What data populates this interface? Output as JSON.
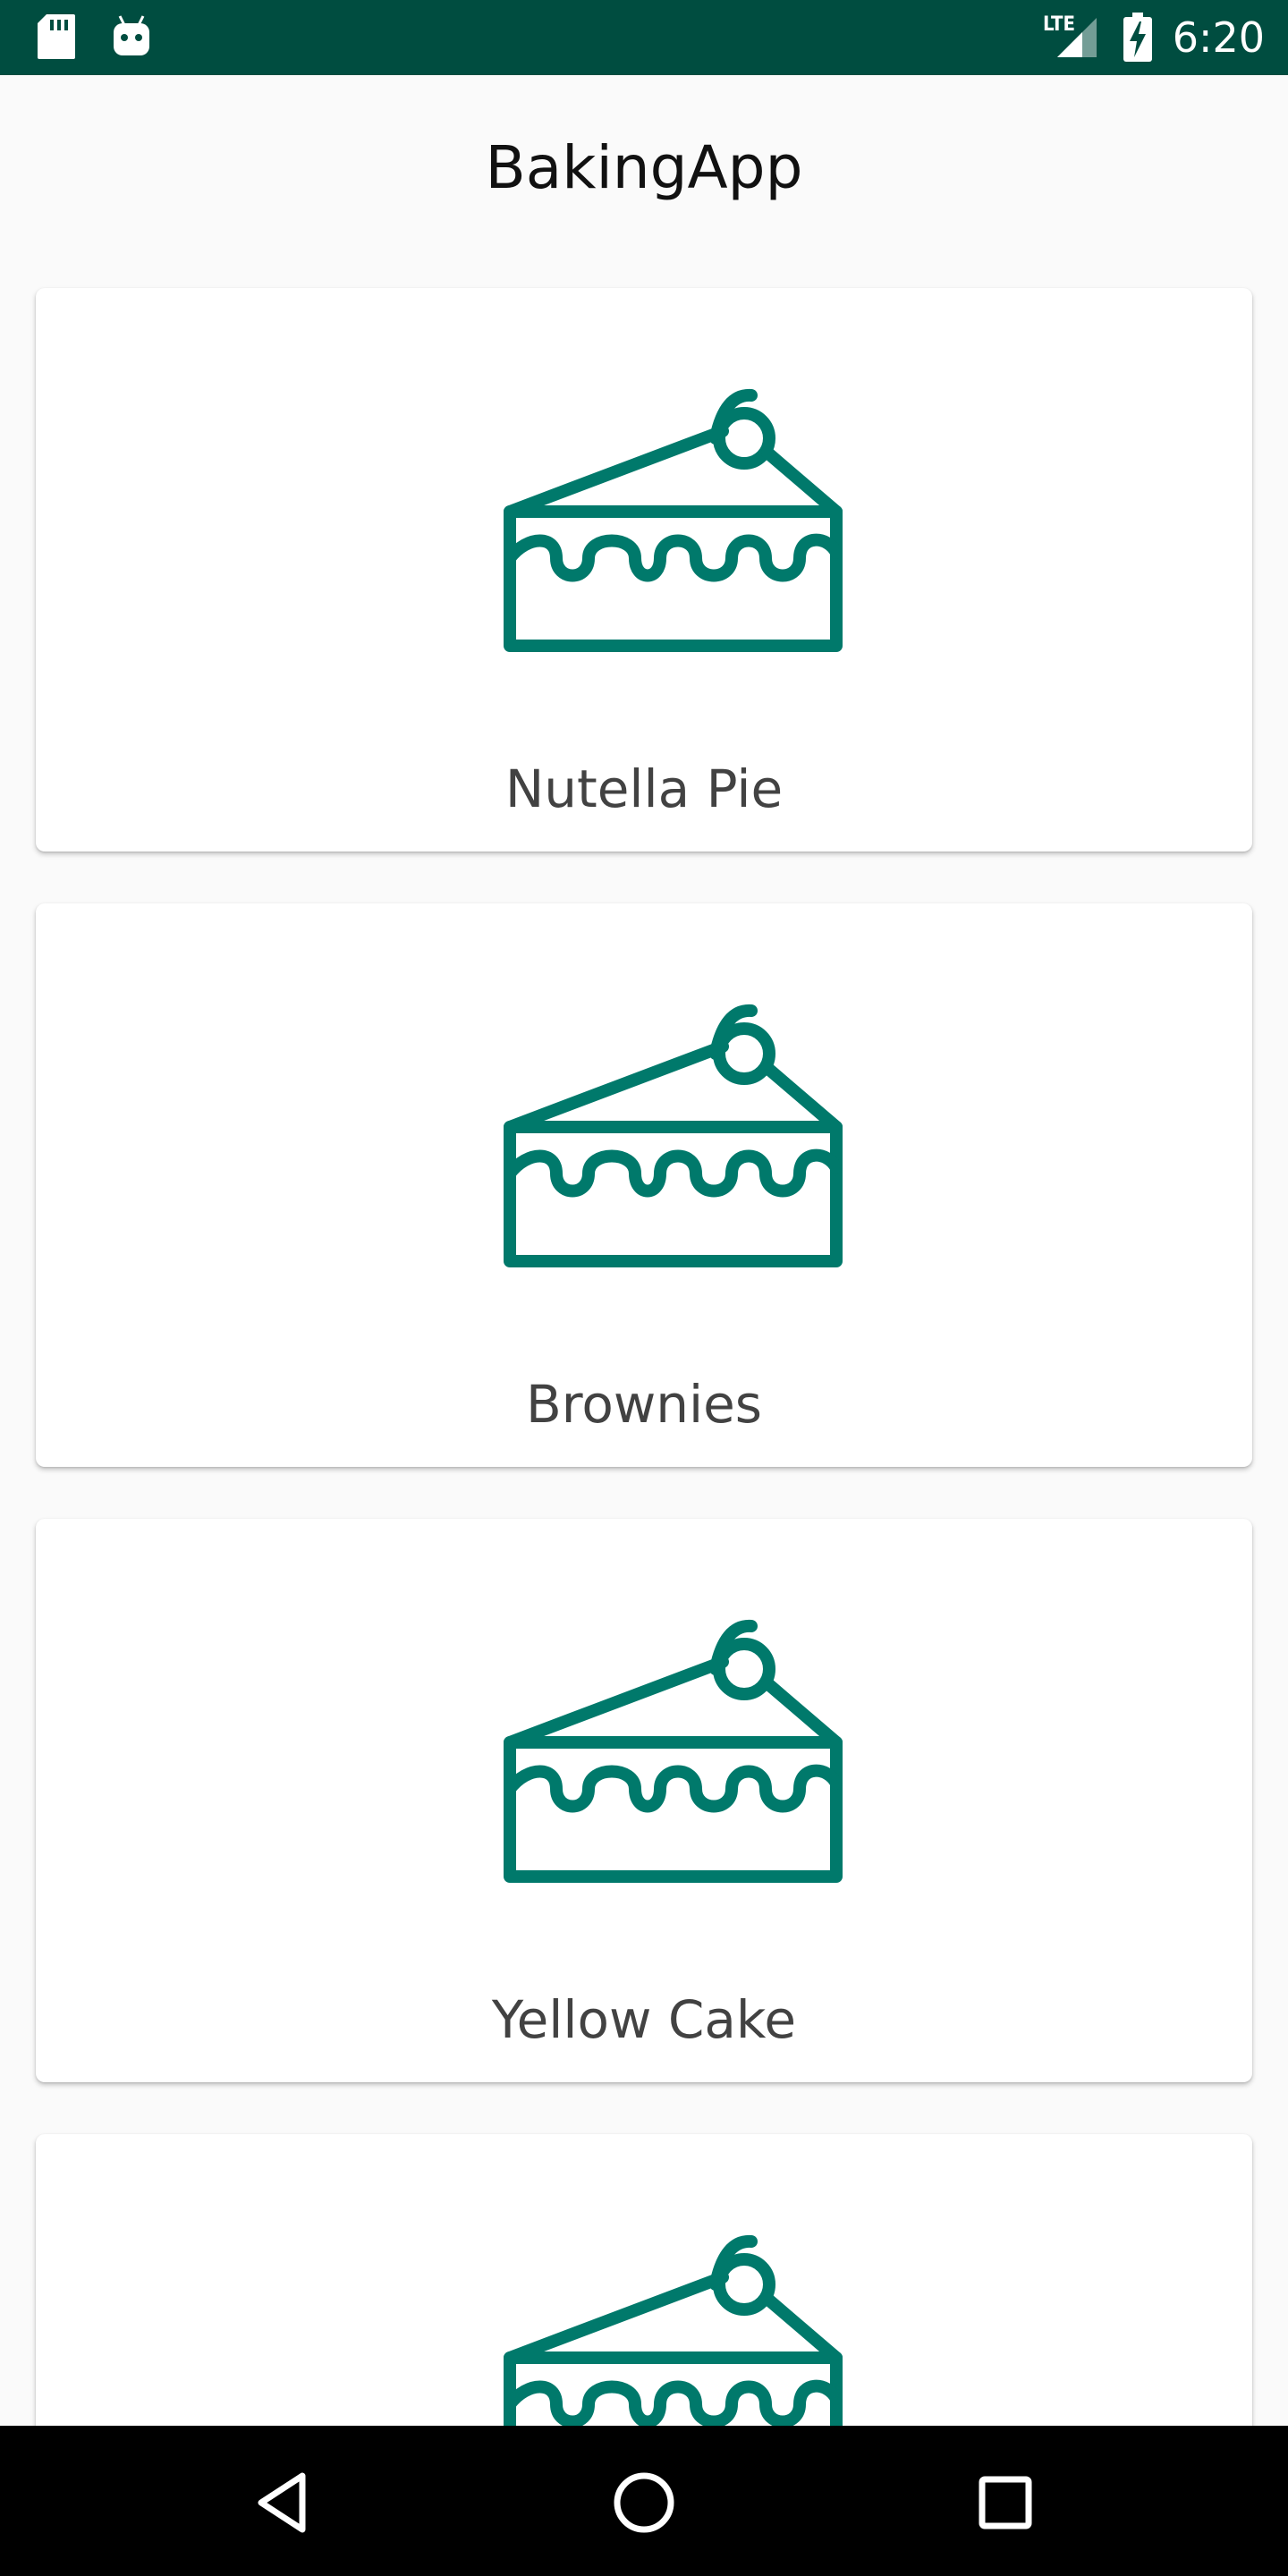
{
  "status_bar": {
    "time": "6:20",
    "network_label": "LTE",
    "icons": [
      "sd-card-icon",
      "android-icon",
      "lte-signal-icon",
      "battery-charging-icon"
    ]
  },
  "app_bar": {
    "title": "BakingApp"
  },
  "recipes": [
    {
      "name": "Nutella Pie",
      "icon": "cake-slice-icon"
    },
    {
      "name": "Brownies",
      "icon": "cake-slice-icon"
    },
    {
      "name": "Yellow Cake",
      "icon": "cake-slice-icon"
    },
    {
      "name": "",
      "icon": "cake-slice-icon"
    }
  ],
  "nav_bar": {
    "buttons": [
      "back-icon",
      "home-icon",
      "recents-icon"
    ]
  },
  "colors": {
    "status_bar": "#004d40",
    "accent": "#00796b",
    "background": "#fafafa",
    "card": "#ffffff",
    "label_text": "#424242"
  }
}
